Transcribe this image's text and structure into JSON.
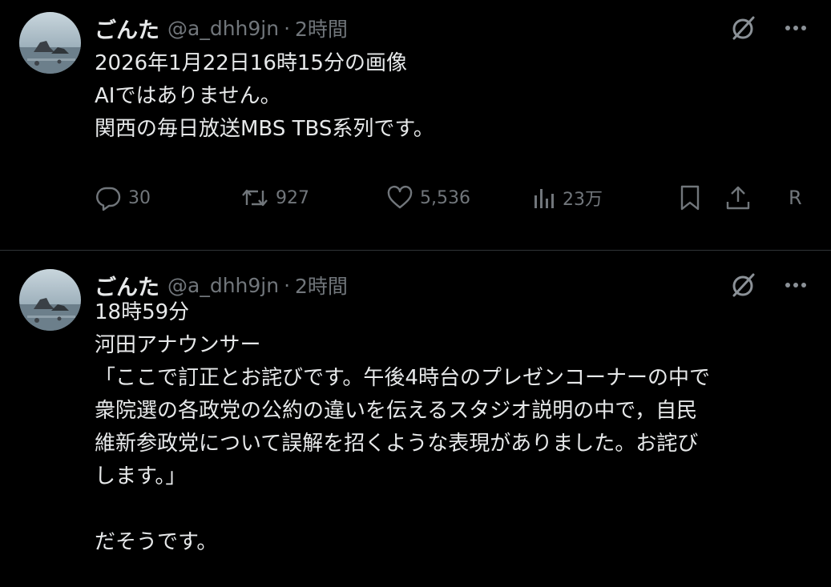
{
  "tweets": [
    {
      "display_name": "ごんた",
      "handle": "@a_dhh9jn",
      "separator": "·",
      "time": "2時間",
      "lines": [
        "2026年1月22日16時15分の画像",
        "AIではありません。",
        "関西の毎日放送MBS TBS系列です。"
      ],
      "actions": {
        "reply_count": "30",
        "retweet_count": "927",
        "like_count": "5,536",
        "view_count": "23万",
        "extra_label": "R"
      }
    },
    {
      "display_name": "ごんた",
      "handle": "@a_dhh9jn",
      "separator": "·",
      "time": "2時間",
      "lines": [
        "18時59分",
        "河田アナウンサー",
        "「ここで訂正とお詫びです。午後4時台のプレゼンコーナーの中で",
        "衆院選の各政党の公約の違いを伝えるスタジオ説明の中で，自民",
        "維新参政党について誤解を招くような表現がありました。お詫び",
        "します。」",
        "",
        "だそうです。"
      ]
    }
  ],
  "icons": {
    "grok": "grok-icon",
    "more": "more-icon",
    "reply": "reply-icon",
    "retweet": "retweet-icon",
    "like": "heart-icon",
    "views": "views-icon",
    "bookmark": "bookmark-icon",
    "share": "share-icon"
  },
  "colors": {
    "background": "#000000",
    "text": "#e7e9ea",
    "secondary": "#71767b",
    "divider": "#2f3336"
  }
}
